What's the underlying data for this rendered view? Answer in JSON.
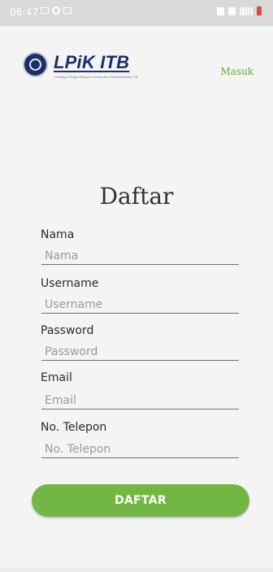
{
  "status_bar": {
    "time": "06:47"
  },
  "header": {
    "logo_title": "LPiK ITB",
    "logo_subtitle": "Lembaga Pengembangan Inovasi dan Kewirausahaan ITB",
    "login_link": "Masuk"
  },
  "page": {
    "title": "Daftar"
  },
  "form": {
    "name_label": "Nama",
    "name_placeholder": "Nama",
    "username_label": "Username",
    "username_placeholder": "Username",
    "password_label": "Password",
    "password_placeholder": "Password",
    "email_label": "Email",
    "email_placeholder": "Email",
    "phone_label": "No. Telepon",
    "phone_placeholder": "No. Telepon",
    "submit_label": "DAFTAR"
  },
  "colors": {
    "accent": "#72b743",
    "brand_blue": "#1d2e71"
  },
  "icons": {
    "status_left": [
      "image-icon",
      "circle-icon",
      "square-icon"
    ],
    "status_right": [
      "alarm-icon",
      "mute-icon",
      "wifi-icon",
      "signal-icon",
      "battery-icon"
    ],
    "logo": "university-seal-icon"
  }
}
